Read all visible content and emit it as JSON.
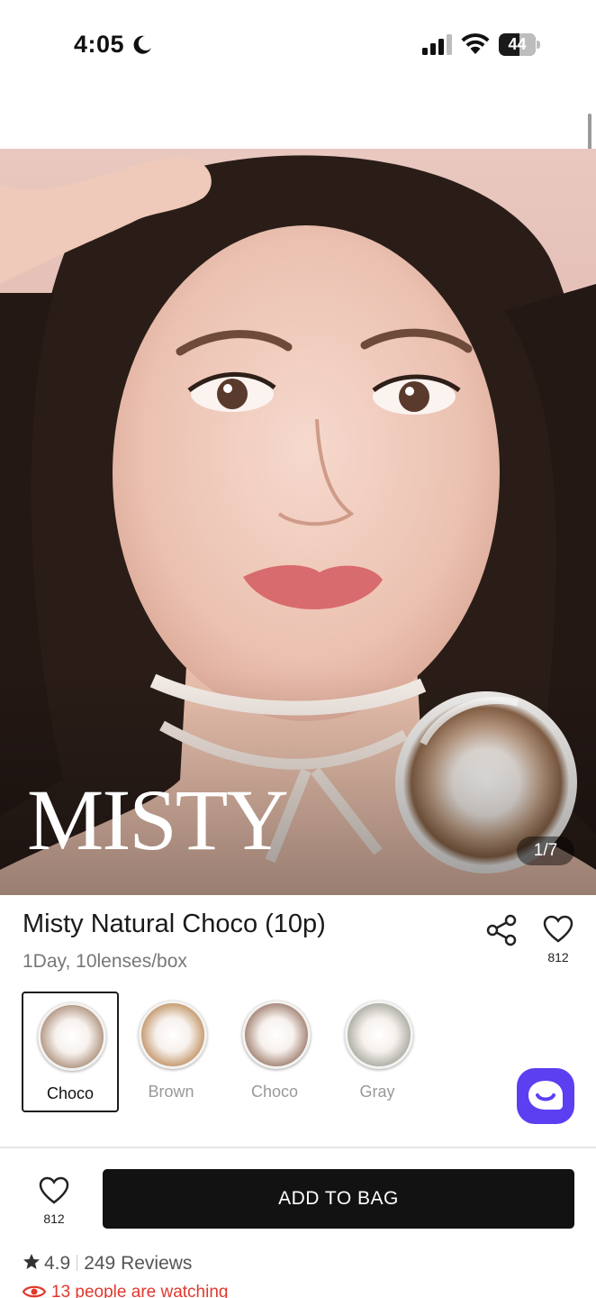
{
  "status_bar": {
    "time": "4:05",
    "battery": "44",
    "icons": [
      "moon-icon",
      "cellular-signal-icon",
      "wifi-icon",
      "battery-icon"
    ]
  },
  "hero": {
    "brand_text": "MISTY",
    "page_indicator": "1/7"
  },
  "product": {
    "title": "Misty Natural Choco (10p)",
    "subtitle": "1Day, 10lenses/box",
    "favorites": "812"
  },
  "variants": [
    {
      "label": "Choco",
      "selected": true,
      "color": "#a08068"
    },
    {
      "label": "Brown",
      "selected": false,
      "color": "#b8834e"
    },
    {
      "label": "Choco",
      "selected": false,
      "color": "#8f6a58"
    },
    {
      "label": "Gray",
      "selected": false,
      "color": "#9a9d92"
    }
  ],
  "actions": {
    "favorites": "812",
    "add_to_bag": "ADD TO BAG"
  },
  "reviews": {
    "rating": "4.9",
    "count_text": "249 Reviews"
  },
  "watching": {
    "text": "13 people are watching"
  },
  "colors": {
    "accent_chat": "#5b3ff0",
    "primary_button": "#121212",
    "alert": "#e0392e"
  }
}
